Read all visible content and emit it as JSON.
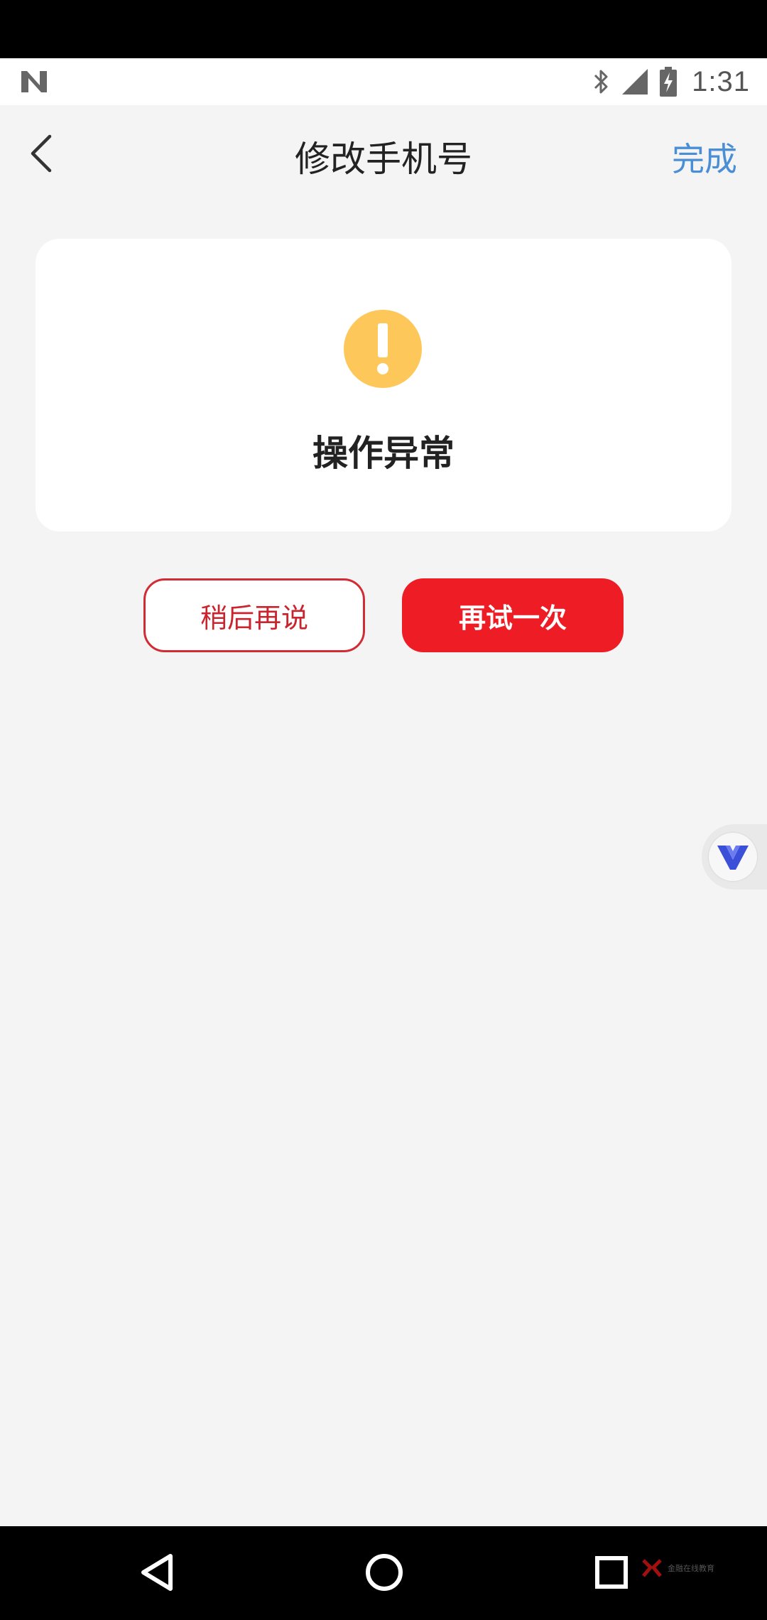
{
  "status_bar": {
    "time": "1:31",
    "icons": [
      "n-logo-icon",
      "bluetooth-icon",
      "signal-icon",
      "battery-charging-icon"
    ]
  },
  "header": {
    "title": "修改手机号",
    "back_icon": "chevron-left-icon",
    "done_label": "完成"
  },
  "card": {
    "icon": "warning-exclamation-icon",
    "message": "操作异常"
  },
  "actions": {
    "later_label": "稍后再说",
    "retry_label": "再试一次"
  },
  "floating_assistant": {
    "icon": "v-logo-icon"
  },
  "nav_bar": {
    "icons": [
      "back-triangle-icon",
      "home-circle-icon",
      "recents-square-icon"
    ],
    "watermark": "金融在线教育"
  },
  "colors": {
    "accent_blue": "#4a8ed6",
    "primary_red": "#ee1c25",
    "warning_yellow": "#fdc75a",
    "background": "#f4f4f4"
  }
}
